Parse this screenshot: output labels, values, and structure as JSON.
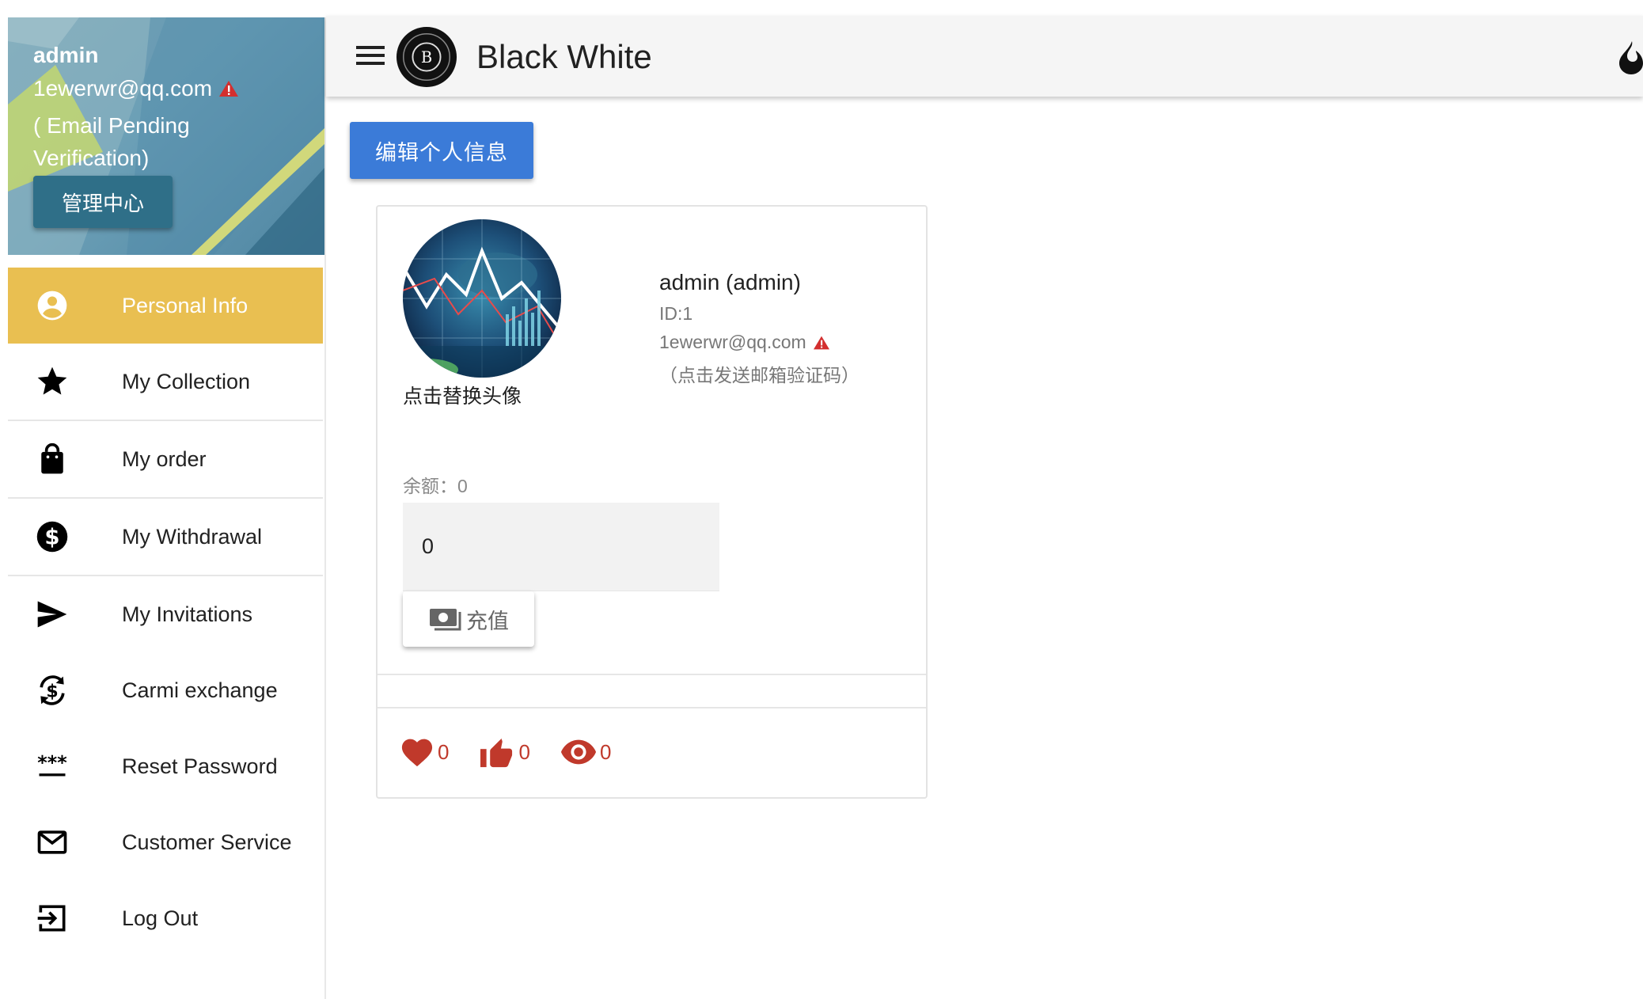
{
  "sidebar": {
    "header": {
      "username": "admin",
      "email": "1ewerwr@qq.com",
      "pending_note": "( Email Pending Verification)",
      "admin_button": "管理中心"
    },
    "items": [
      {
        "label": "Personal Info",
        "icon": "account-circle-icon",
        "active": true
      },
      {
        "label": "My Collection",
        "icon": "star-icon"
      },
      {
        "label": "My order",
        "icon": "shopping-bag-icon"
      },
      {
        "label": "My Withdrawal",
        "icon": "dollar-circle-icon"
      },
      {
        "label": "My Invitations",
        "icon": "send-icon"
      },
      {
        "label": "Carmi exchange",
        "icon": "currency-exchange-icon"
      },
      {
        "label": "Reset Password",
        "icon": "password-icon"
      },
      {
        "label": "Customer Service",
        "icon": "mail-icon"
      },
      {
        "label": "Log Out",
        "icon": "logout-icon"
      }
    ]
  },
  "topbar": {
    "title": "Black White",
    "logo_letter": "B"
  },
  "main": {
    "edit_button": "编辑个人信息",
    "profile": {
      "avatar_caption": "点击替换头像",
      "display_name": "admin (admin)",
      "id_line": "ID:1",
      "email": "1ewerwr@qq.com",
      "verify_link": "（点击发送邮箱验证码）",
      "balance_label": "余额：0",
      "balance_input_value": "0",
      "recharge_button": "充值"
    },
    "stats": {
      "likes": "0",
      "thumbs": "0",
      "views": "0"
    }
  },
  "colors": {
    "active_nav": "#e9bf51",
    "primary_button": "#3b7bd8",
    "stat_red": "#c0392b",
    "warning_red": "#d32f2f"
  }
}
